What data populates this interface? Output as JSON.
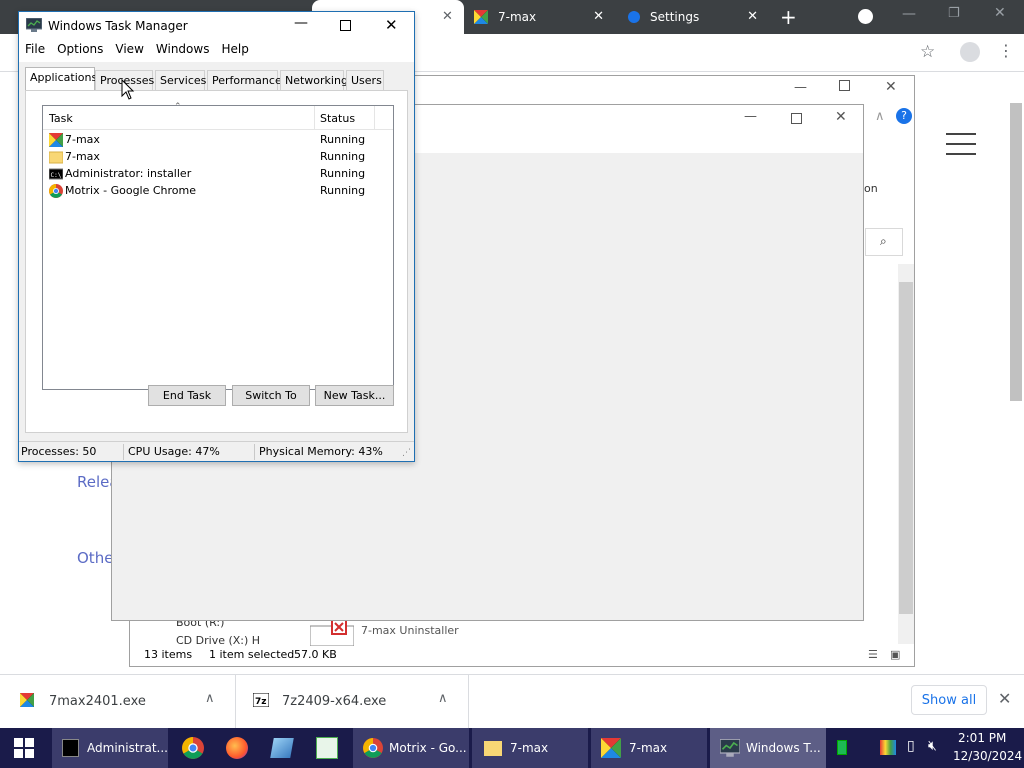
{
  "browser": {
    "tabs": [
      {
        "label": "7-max"
      },
      {
        "label": "Settings"
      }
    ],
    "new_tab": "+"
  },
  "webpage": {
    "link_release": "Relea",
    "link_other": "Othe",
    "side_text": "on"
  },
  "explorer": {
    "status_items": "13 items",
    "status_selected": "1 item selected",
    "status_size": "57.0 KB",
    "nav_item_boot": "Boot (R:)",
    "nav_item_cd": "CD Drive (X:) H",
    "file_label": "7-max Uninstaller"
  },
  "task_manager": {
    "title": "Windows Task Manager",
    "menu": [
      "File",
      "Options",
      "View",
      "Windows",
      "Help"
    ],
    "tabs": [
      "Applications",
      "Processes",
      "Services",
      "Performance",
      "Networking",
      "Users"
    ],
    "columns": {
      "task": "Task",
      "status": "Status"
    },
    "rows": [
      {
        "task": "7-max",
        "status": "Running",
        "icon": "seven-max-icon"
      },
      {
        "task": "7-max",
        "status": "Running",
        "icon": "folder-icon"
      },
      {
        "task": "Administrator:  installer",
        "status": "Running",
        "icon": "cmd-icon"
      },
      {
        "task": "Motrix - Google Chrome",
        "status": "Running",
        "icon": "chrome-icon"
      }
    ],
    "buttons": {
      "end_task": "End Task",
      "switch_to": "Switch To",
      "new_task": "New Task..."
    },
    "status": {
      "processes": "Processes: 50",
      "cpu": "CPU Usage: 47%",
      "memory": "Physical Memory: 43%"
    }
  },
  "downloads": {
    "items": [
      {
        "name": "7max2401.exe"
      },
      {
        "name": "7z2409-x64.exe"
      }
    ],
    "show_all": "Show all"
  },
  "taskbar": {
    "buttons": [
      {
        "label": "Administrat..."
      },
      {
        "label": "Motrix - Go..."
      },
      {
        "label": "7-max"
      },
      {
        "label": "7-max"
      },
      {
        "label": "Windows T..."
      }
    ],
    "time": "2:01 PM",
    "date": "12/30/2024"
  },
  "colors": {
    "taskbar": "#1a1b4a",
    "chrome_tabstrip": "#3c4043",
    "accent_link": "#5b6bc5"
  }
}
